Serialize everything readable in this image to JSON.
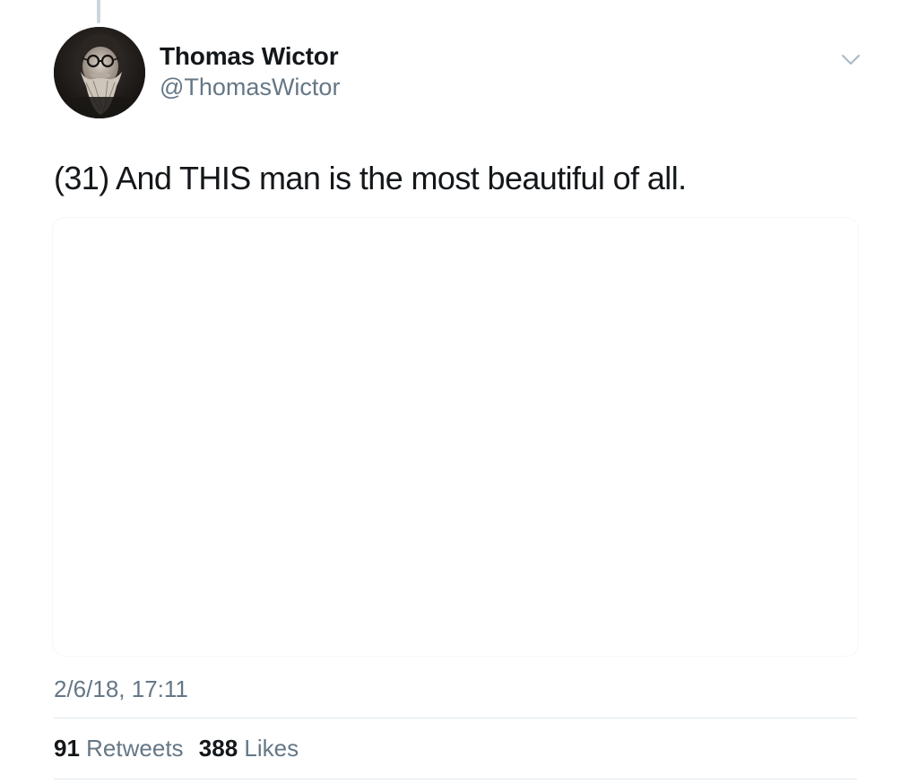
{
  "tweet": {
    "author": {
      "display_name": "Thomas Wictor",
      "handle": "@ThomasWictor",
      "avatar_icon": "avatar-portrait"
    },
    "menu_icon": "chevron-down-icon",
    "text": "(31) And THIS man is the most beautiful of all.",
    "timestamp": "2/6/18, 17:11",
    "stats": {
      "retweets_count": "91",
      "retweets_label": "Retweets",
      "likes_count": "388",
      "likes_label": "Likes"
    }
  },
  "colors": {
    "text_primary": "#14171a",
    "text_secondary": "#657786",
    "divider": "#e1e8ed",
    "thread_line": "#ccd6dd"
  }
}
